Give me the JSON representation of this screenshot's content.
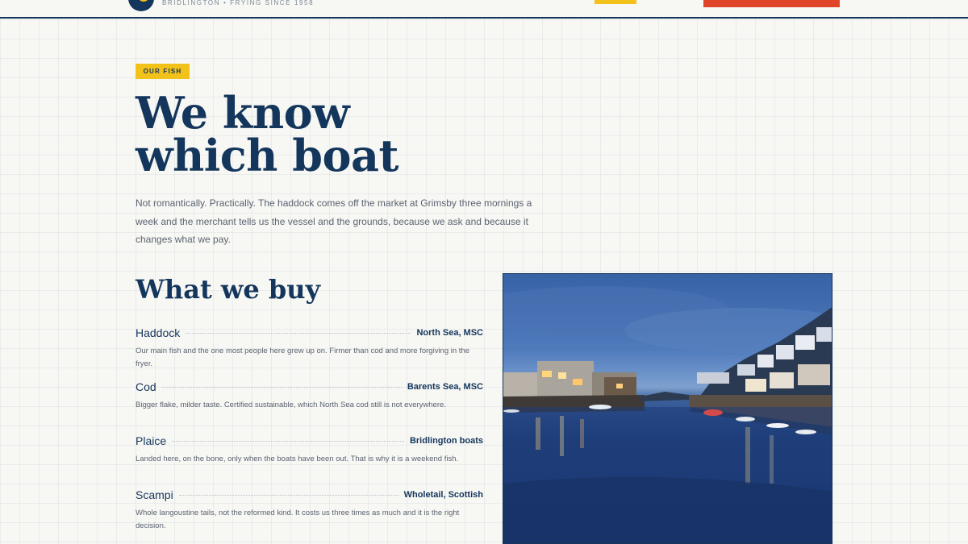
{
  "header": {
    "tagline": "BRIDLINGTON • FRYING SINCE 1958"
  },
  "hero": {
    "eyebrow": "OUR FISH",
    "title_line1": "We know",
    "title_line2": "which boat",
    "intro": "Not romantically. Practically. The haddock comes off the market at Grimsby three mornings a week and the merchant tells us the vessel and the grounds, because we ask and because it changes what we pay."
  },
  "buy": {
    "title": "What we buy",
    "items": [
      {
        "name": "Haddock",
        "origin": "North Sea, MSC",
        "description": "Our main fish and the one most people here grew up on. Firmer than cod and more forgiving in the fryer."
      },
      {
        "name": "Cod",
        "origin": "Barents Sea, MSC",
        "description": "Bigger flake, milder taste. Certified sustainable, which North Sea cod still is not everywhere."
      },
      {
        "name": "Plaice",
        "origin": "Bridlington boats",
        "description": "Landed here, on the bone, only when the boats have been out. That is why it is a weekend fish."
      },
      {
        "name": "Scampi",
        "origin": "Wholetail, Scottish",
        "description": "Whole langoustine tails, not the reformed kind. It costs us three times as much and it is the right decision."
      }
    ]
  },
  "colors": {
    "navy": "#14365c",
    "yellow": "#f2c21b",
    "red": "#e0452a"
  }
}
